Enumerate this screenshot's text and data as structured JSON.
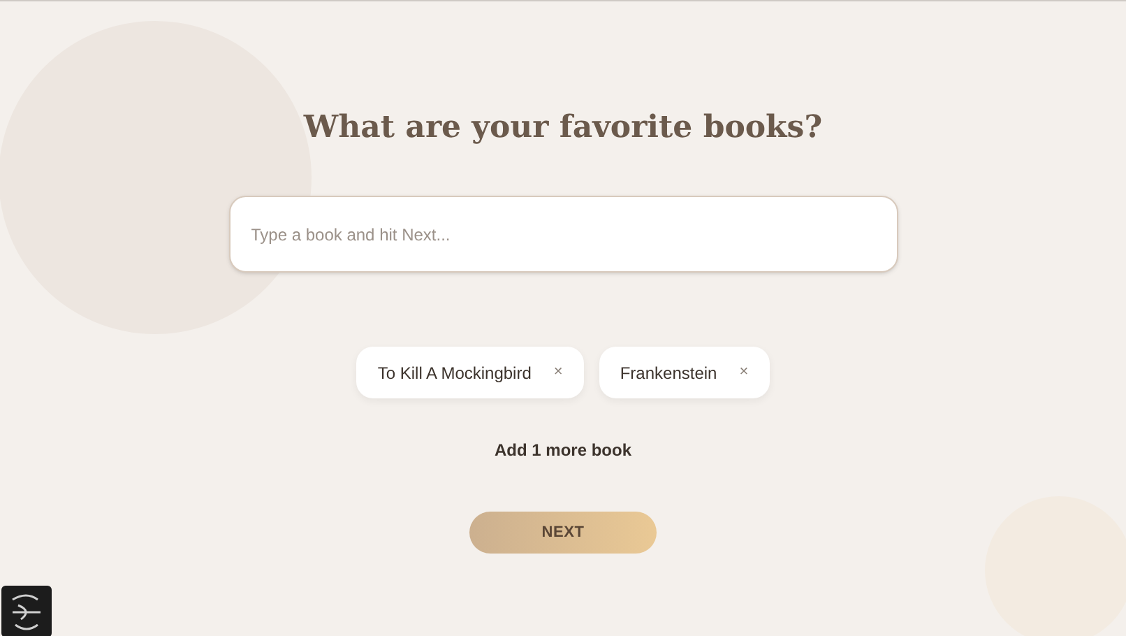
{
  "heading": "What are your favorite books?",
  "search": {
    "placeholder": "Type a book and hit Next..."
  },
  "chips": [
    {
      "label": "To Kill A Mockingbird",
      "remove": "×"
    },
    {
      "label": "Frankenstein",
      "remove": "×"
    }
  ],
  "hint": "Add 1 more book",
  "next_button": "NEXT"
}
